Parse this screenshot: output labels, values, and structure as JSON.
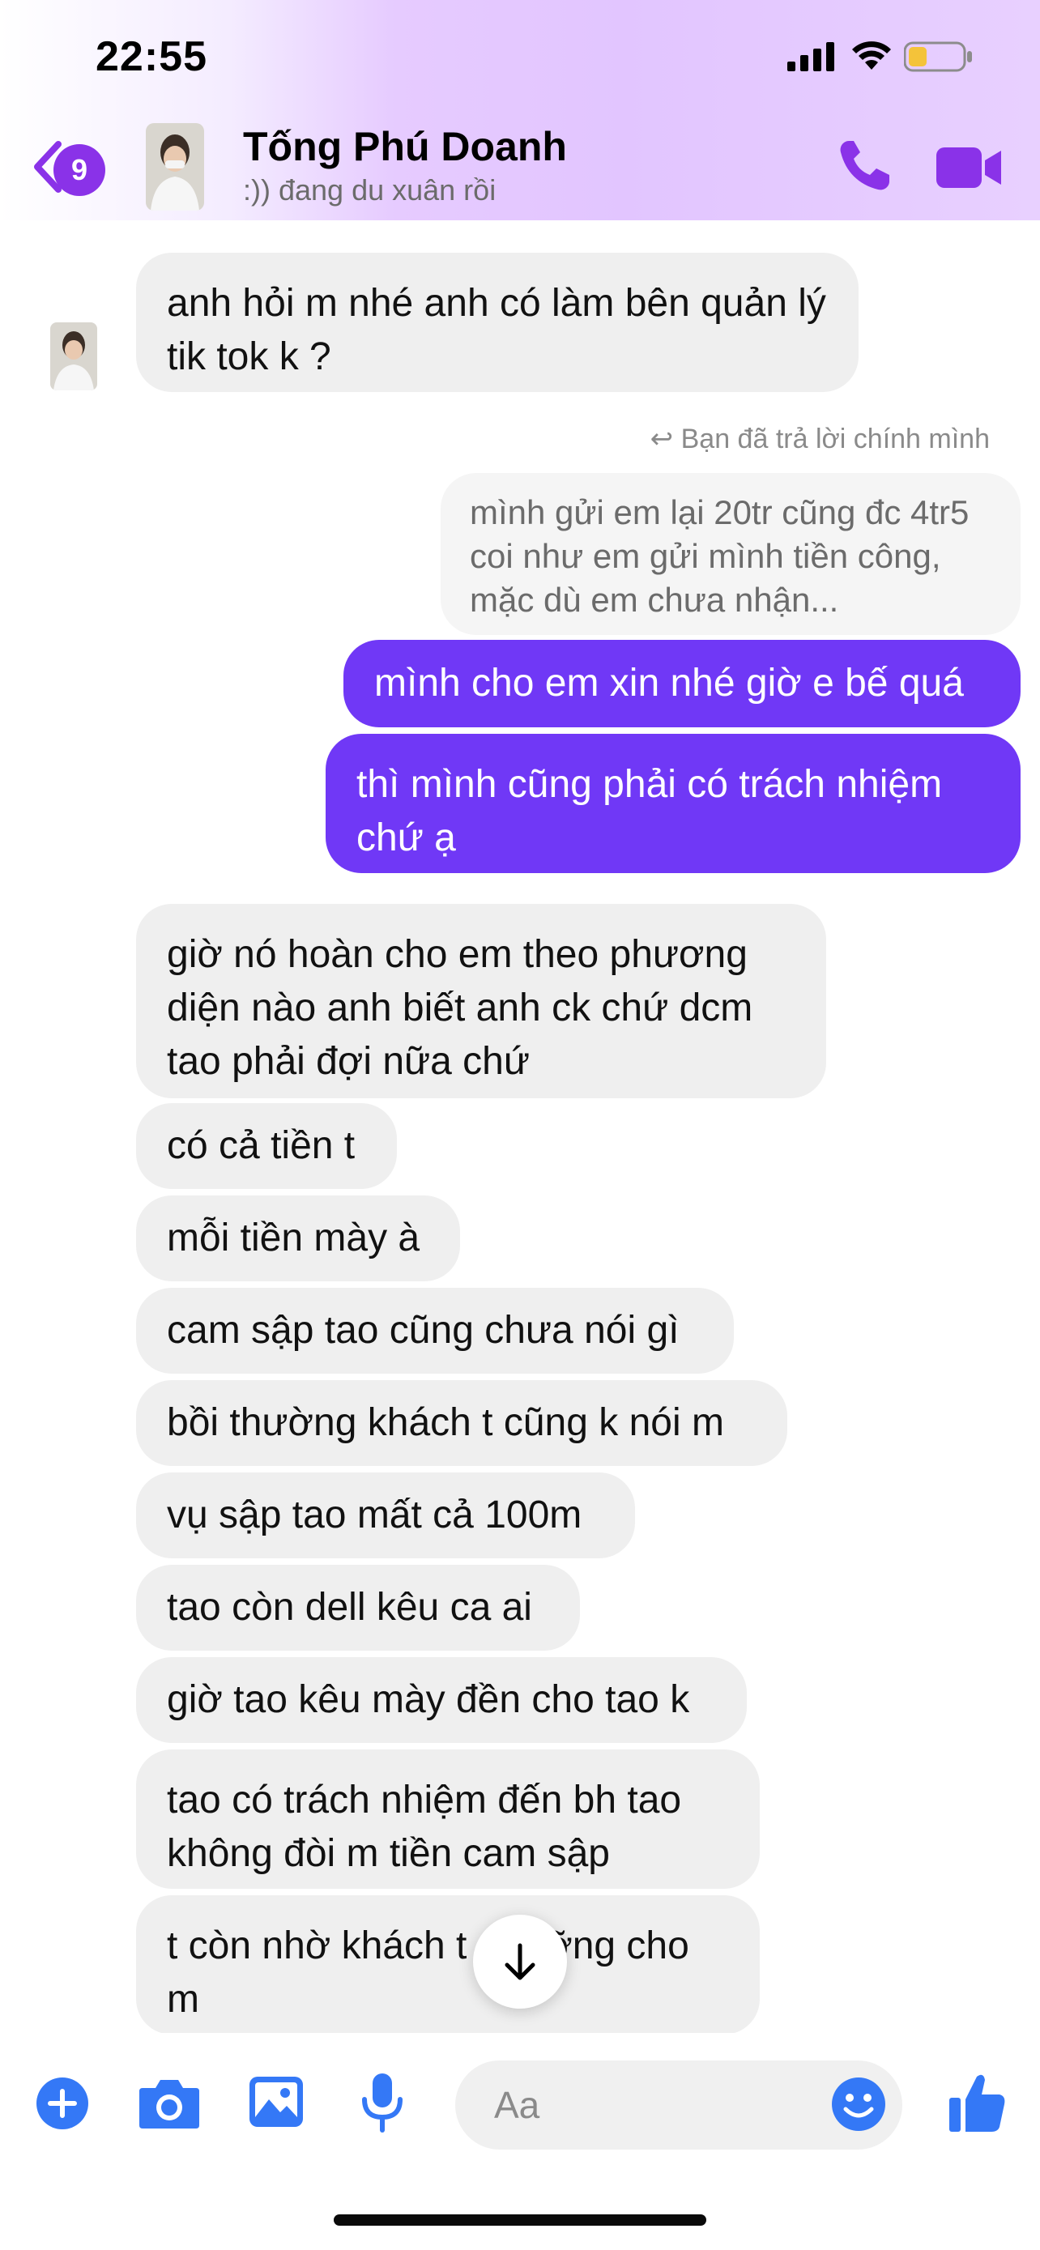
{
  "status_bar": {
    "time": "22:55"
  },
  "header": {
    "unread_count": "9",
    "contact_name": "Tống Phú Doanh",
    "contact_status": ":)) đang du xuân rồi"
  },
  "messages": {
    "m1": "anh hỏi m nhé anh có làm bên quản lý tik tok k ?",
    "reply_note": "Bạn đã trả lời chính mình",
    "reply_quote": "mình gửi em lại 20tr cũng đc 4tr5 coi như em gửi mình tiền công, mặc dù em chưa nhận...",
    "out1": "mình cho em xin nhé giờ e bế quá",
    "out2": "thì mình cũng phải có trách nhiệm chứ ạ",
    "in1": "giờ nó hoàn cho em theo phương diện nào anh biết anh ck chứ dcm tao phải đợi nữa chứ",
    "in2": "có cả tiền t",
    "in3": "mỗi tiền mày à",
    "in4": "cam sập tao cũng chưa nói gì",
    "in5": "bồi thường khách t cũng k nói m",
    "in6": "vụ sập tao mất cả 100m",
    "in7": "tao còn dell kêu ca ai",
    "in8": "giờ tao kêu mày đền cho tao k",
    "in9": "tao có trách nhiệm đến bh tao không đòi m tiền cam sập",
    "in10": "t còn nhờ khách t ngưỡng cho m"
  },
  "composer": {
    "placeholder": "Aa"
  },
  "icons": {
    "back": "chevron-left-icon",
    "call": "phone-icon",
    "video": "video-camera-icon",
    "add": "plus-circle-icon",
    "camera": "camera-icon",
    "gallery": "image-icon",
    "mic": "microphone-icon",
    "emoji": "smiley-icon",
    "like": "thumbs-up-icon",
    "scroll": "arrow-down-icon"
  },
  "colors": {
    "accent": "#8a32e8",
    "outgoing_bubble": "#7038f6",
    "incoming_bubble": "#efefef",
    "composer_icons": "#3478f6"
  }
}
